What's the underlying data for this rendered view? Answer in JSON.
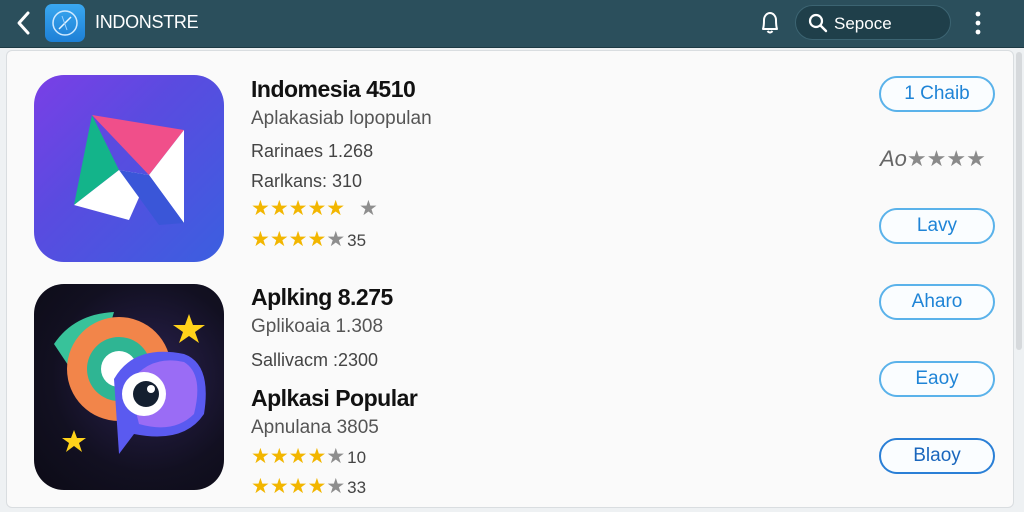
{
  "header": {
    "app_title": "INDONSTRE",
    "search_text": "Sepoce"
  },
  "colors": {
    "topbar": "#2b4f5c",
    "star": "#f2b600",
    "button_border": "#5ab2ea",
    "button_text": "#1f84d6"
  },
  "icons": {
    "back": "chevron-left-icon",
    "logo": "app-store-icon",
    "bell": "bell-icon",
    "search": "search-icon",
    "menu": "kebab-menu-icon"
  },
  "apps": [
    {
      "title": "Indomesia 4510",
      "subtitle": "Aplakasiab lopopulan",
      "meta1": "Rarinaes 1.268",
      "meta2": "Rarlkans: 310",
      "stars_a": "★★★★★",
      "stars_a_off": "★",
      "stars_b": "★★★★",
      "stars_b_off": "★",
      "stars_b_num": "35",
      "stars_a_value": 5,
      "stars_b_value": 4
    },
    {
      "title": "Aplking 8.275",
      "subtitle": "Gplikoaia 1.308",
      "meta1": "Sallivacm :2300",
      "title2": "Aplkasi Popular",
      "subtitle2": "Apnulana 3805",
      "stars_c": "★★★★",
      "stars_c_off": "★",
      "stars_c_num": "10",
      "stars_d": "★★★★",
      "stars_d_off": "★",
      "stars_d_num": "33",
      "stars_c_value": 4,
      "stars_d_value": 4
    }
  ],
  "side": {
    "rating_label": "Ao",
    "rating_stars": "★★★★"
  },
  "buttons": [
    "1 Chaib",
    "Lavy",
    "Aharo",
    "Eaoy",
    "Blaoy"
  ]
}
